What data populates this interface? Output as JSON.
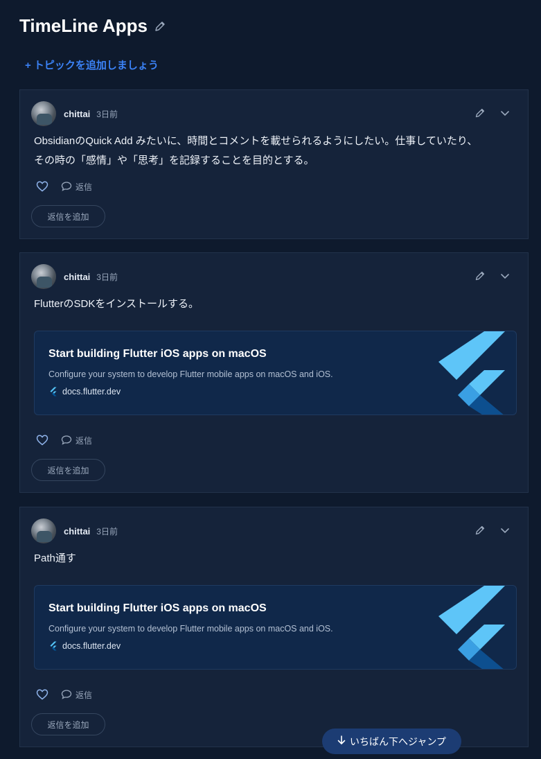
{
  "page": {
    "title": "TimeLine Apps",
    "add_topic": "+ トピックを追加しましょう",
    "jump_label": "いちばん下へジャンプ"
  },
  "posts": [
    {
      "author": "chittai",
      "time": "3日前",
      "body_line1": "ObsidianのQuick Add みたいに、時間とコメントを載せられるようにしたい。仕事していたり、",
      "body_line2": "その時の「感情」や「思考」を記録することを目的とする。",
      "reply_label": "返信",
      "add_reply_label": "返信を追加"
    },
    {
      "author": "chittai",
      "time": "3日前",
      "body_line1": "FlutterのSDKをインストールする。",
      "link": {
        "title": "Start building Flutter iOS apps on macOS",
        "description": "Configure your system to develop Flutter mobile apps on macOS and iOS.",
        "domain": "docs.flutter.dev"
      },
      "reply_label": "返信",
      "add_reply_label": "返信を追加"
    },
    {
      "author": "chittai",
      "time": "3日前",
      "body_line1": "Path通す",
      "link": {
        "title": "Start building Flutter iOS apps on macOS",
        "description": "Configure your system to develop Flutter mobile apps on macOS and iOS.",
        "domain": "docs.flutter.dev"
      },
      "reply_label": "返信",
      "add_reply_label": "返信を追加"
    }
  ],
  "colors": {
    "background": "#0e1a2d",
    "card": "#15233a",
    "accent": "#3b82f6",
    "link_card": "#10284a"
  },
  "icons": {
    "title_edit": "pencil-icon",
    "post_edit": "pencil-icon",
    "post_menu": "chevron-down-icon",
    "like": "heart-icon",
    "reply": "speech-bubble-icon",
    "link_logo": "flutter-logo",
    "jump": "arrow-down-icon"
  }
}
